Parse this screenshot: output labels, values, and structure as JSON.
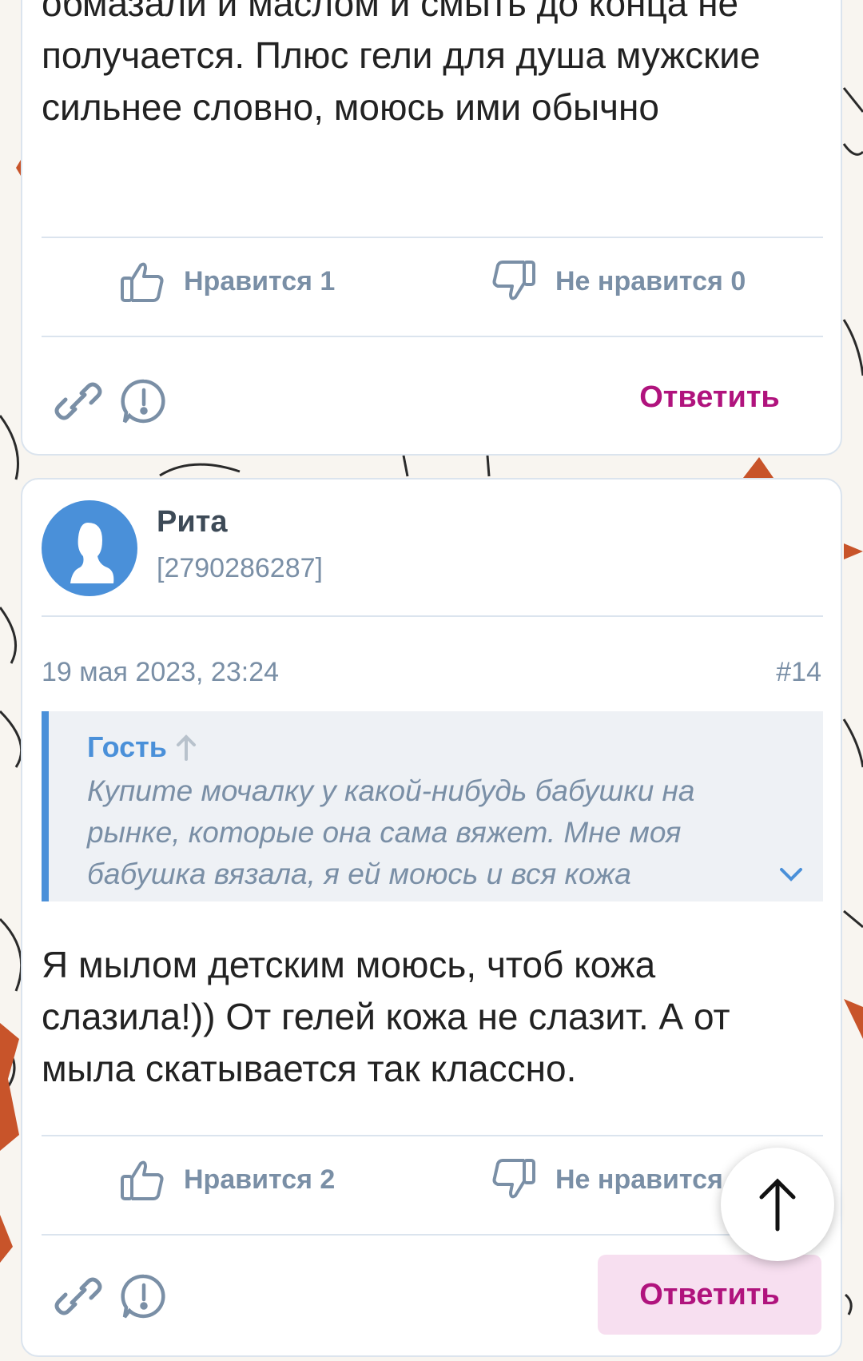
{
  "comment1": {
    "text": "обмазали и маслом и смыть до конца не получается. Плюс гели для душа мужские сильнее словно, моюсь ими обычно",
    "like_label": "Нравится 1",
    "dislike_label": "Не нравится 0",
    "reply_label": "Ответить"
  },
  "comment2": {
    "author": "Рита",
    "author_id": "[2790286287]",
    "date": "19 мая 2023, 23:24",
    "number": "#14",
    "quote": {
      "author": "Гость",
      "text": "Купите мочалку у какой-нибудь бабушки на рынке, которые она сама вяжет. Мне моя бабушка вязала, я ей моюсь и вся кожа"
    },
    "text": "Я мылом детским моюсь, чтоб кожа слазила!)) От гелей кожа не слазит. А от мыла скатывается так классно.",
    "like_label": "Нравится 2",
    "dislike_label": "Не нравится",
    "reply_label": "Ответить"
  },
  "icons": {
    "like": "thumbs-up-icon",
    "dislike": "thumbs-down-icon",
    "link": "link-icon",
    "report": "report-icon",
    "scroll_top": "arrow-up-icon"
  },
  "colors": {
    "accent": "#b0137d",
    "link_blue": "#4a90d9",
    "muted": "#7a8fa6",
    "border": "#dbe4ee",
    "quote_bg": "#eef1f5",
    "reply_bg": "#f7dff0",
    "decor_orange": "#c8542a"
  }
}
